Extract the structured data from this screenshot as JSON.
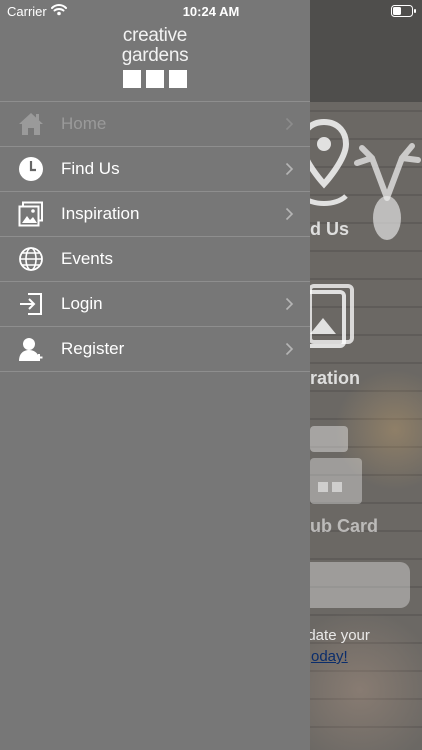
{
  "status_bar": {
    "carrier": "Carrier",
    "time": "10:24 AM"
  },
  "brand": {
    "line1": "creative",
    "line2": "gardens"
  },
  "menu": {
    "items": [
      {
        "label": "Home",
        "icon": "home-icon",
        "chevron": true,
        "muted": true
      },
      {
        "label": "Find Us",
        "icon": "clock-icon",
        "chevron": true,
        "muted": false
      },
      {
        "label": "Inspiration",
        "icon": "gallery-icon",
        "chevron": true,
        "muted": false
      },
      {
        "label": "Events",
        "icon": "globe-icon",
        "chevron": false,
        "muted": false
      },
      {
        "label": "Login",
        "icon": "login-icon",
        "chevron": true,
        "muted": false
      },
      {
        "label": "Register",
        "icon": "add-user-icon",
        "chevron": true,
        "muted": false
      }
    ]
  },
  "background": {
    "tile1_label": "d Us",
    "tile2_label": "ration",
    "tile3_label": "ub Card",
    "text_line": "pdate your",
    "link_text": "oday!"
  },
  "colors": {
    "drawer": "#777777",
    "divider": "#8e8e8e",
    "text": "#ffffff",
    "muted_text": "#9a9a9a"
  }
}
